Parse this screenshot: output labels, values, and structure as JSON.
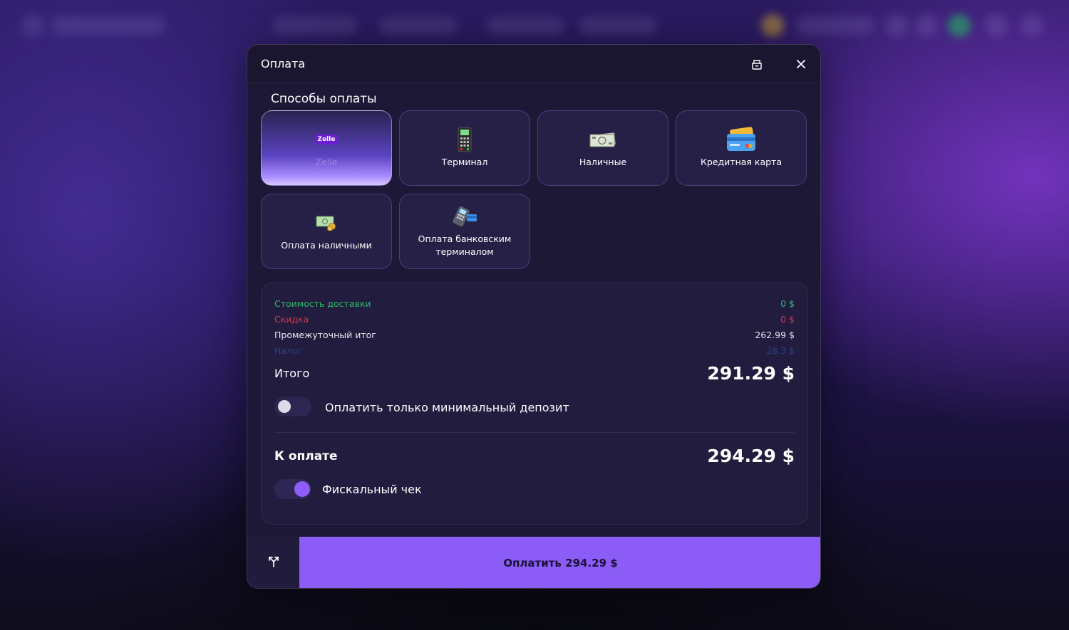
{
  "modal": {
    "title": "Оплата",
    "section_title": "Способы оплаты"
  },
  "payment_methods": [
    {
      "label": "Zelle",
      "icon": "zelle-logo",
      "badge": "Zelle",
      "selected": true
    },
    {
      "label": "Терминал",
      "icon": "terminal-icon",
      "selected": false
    },
    {
      "label": "Наличные",
      "icon": "cash-icon",
      "selected": false
    },
    {
      "label": "Кредитная карта",
      "icon": "credit-card-icon",
      "selected": false
    },
    {
      "label": "Оплата наличными",
      "icon": "cash-coins-icon",
      "selected": false
    },
    {
      "label": "Оплата банковским терминалом",
      "icon": "bank-terminal-icon",
      "selected": false
    }
  ],
  "summary": {
    "delivery": {
      "label": "Стоимость доставки",
      "value": "0 $"
    },
    "discount": {
      "label": "Скидка",
      "value": "0 $"
    },
    "subtotal": {
      "label": "Промежуточный итог",
      "value": "262.99 $"
    },
    "tax": {
      "label": "Налог",
      "value": "28.3 $"
    },
    "total": {
      "label": "Итого",
      "value": "291.29 $"
    },
    "min_deposit": {
      "label": "Оплатить только минимальный депозит",
      "enabled": false
    },
    "to_pay": {
      "label": "К оплате",
      "value": "294.29 $"
    },
    "fiscal_receipt": {
      "label": "Фискальный чек",
      "enabled": true
    }
  },
  "footer": {
    "pay_button_label": "Оплатить 294.29 $"
  },
  "colors": {
    "accent": "#8b5cf6",
    "delivery": "#2fb86a",
    "discount": "#d13a52",
    "tax": "#2d3f86"
  }
}
